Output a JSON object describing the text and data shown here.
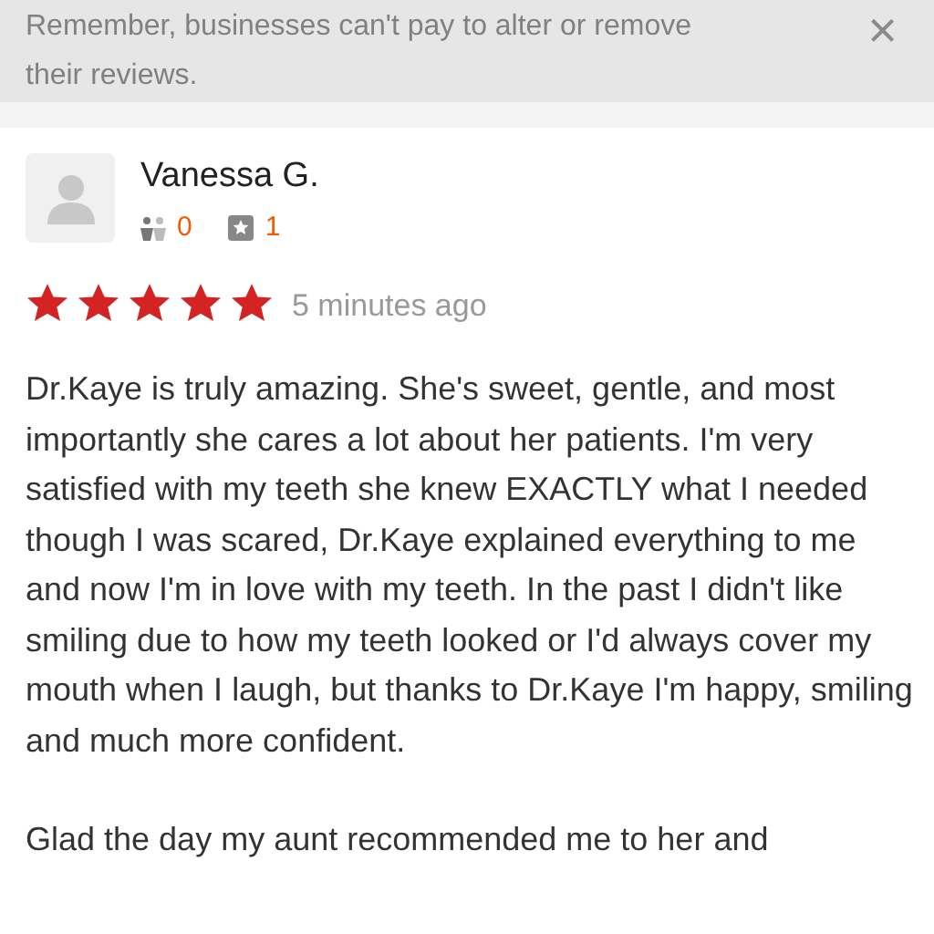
{
  "notice": {
    "text": "Remember, businesses can't pay to alter or remove their reviews.",
    "close": "×"
  },
  "review": {
    "author": "Vanessa G.",
    "friends": "0",
    "reviews": "1",
    "stars": 5,
    "time": "5 minutes ago",
    "paragraphs": [
      "Dr.Kaye is truly amazing. She's sweet, gentle, and most importantly she cares a lot about her patients. I'm very satisfied with my teeth she knew EXACTLY what I needed though I was scared, Dr.Kaye explained everything to me and now I'm in love with my teeth. In the past I didn't like smiling due to how my teeth looked or I'd always cover my mouth when I laugh, but thanks to Dr.Kaye I'm happy, smiling and much more confident.",
      "Glad the day my aunt recommended me to her and"
    ]
  }
}
